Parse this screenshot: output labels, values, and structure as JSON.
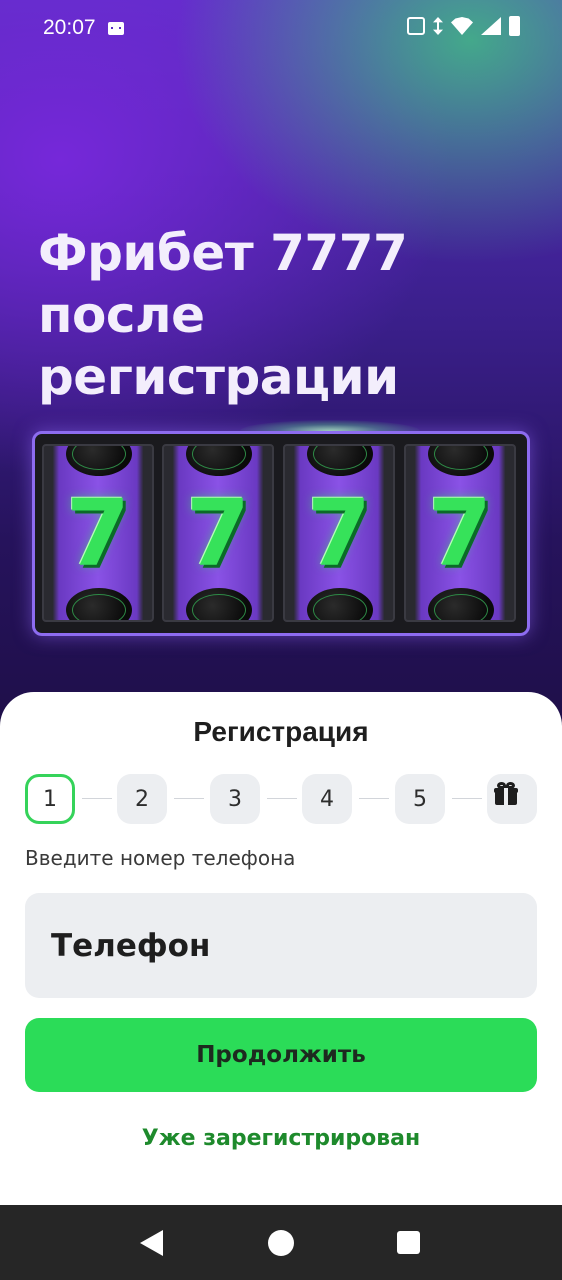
{
  "status_bar": {
    "time": "20:07",
    "icons": [
      "message-icon",
      "mute-icon",
      "data-arrows-icon",
      "wifi-icon",
      "signal-icon",
      "battery-icon"
    ]
  },
  "hero": {
    "headline_lines": [
      "Фрибет 7777",
      "после",
      "регистрации"
    ],
    "slot_reels": [
      "7",
      "7",
      "7",
      "7"
    ],
    "accent": "#36e25a"
  },
  "registration": {
    "title": "Регистрация",
    "steps": [
      "1",
      "2",
      "3",
      "4",
      "5"
    ],
    "active_step": "1",
    "prompt": "Введите номер телефона",
    "phone_placeholder": "Телефон",
    "continue_label": "Продолжить",
    "login_link": "Уже зарегистрирован"
  },
  "colors": {
    "primary_green": "#2bdc58",
    "link_green": "#1e8a2c",
    "purple_border": "#8d6cf0"
  }
}
